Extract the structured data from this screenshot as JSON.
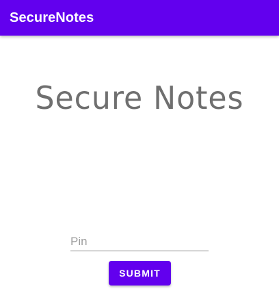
{
  "app_bar": {
    "title": "SecureNotes"
  },
  "main": {
    "hero_title": "Secure Notes",
    "pin_input": {
      "placeholder": "Pin",
      "value": ""
    },
    "submit_label": "SUBMIT"
  },
  "colors": {
    "primary": "#6200EE",
    "hero_text": "#6F6F6F",
    "placeholder": "#9E9E9E"
  }
}
